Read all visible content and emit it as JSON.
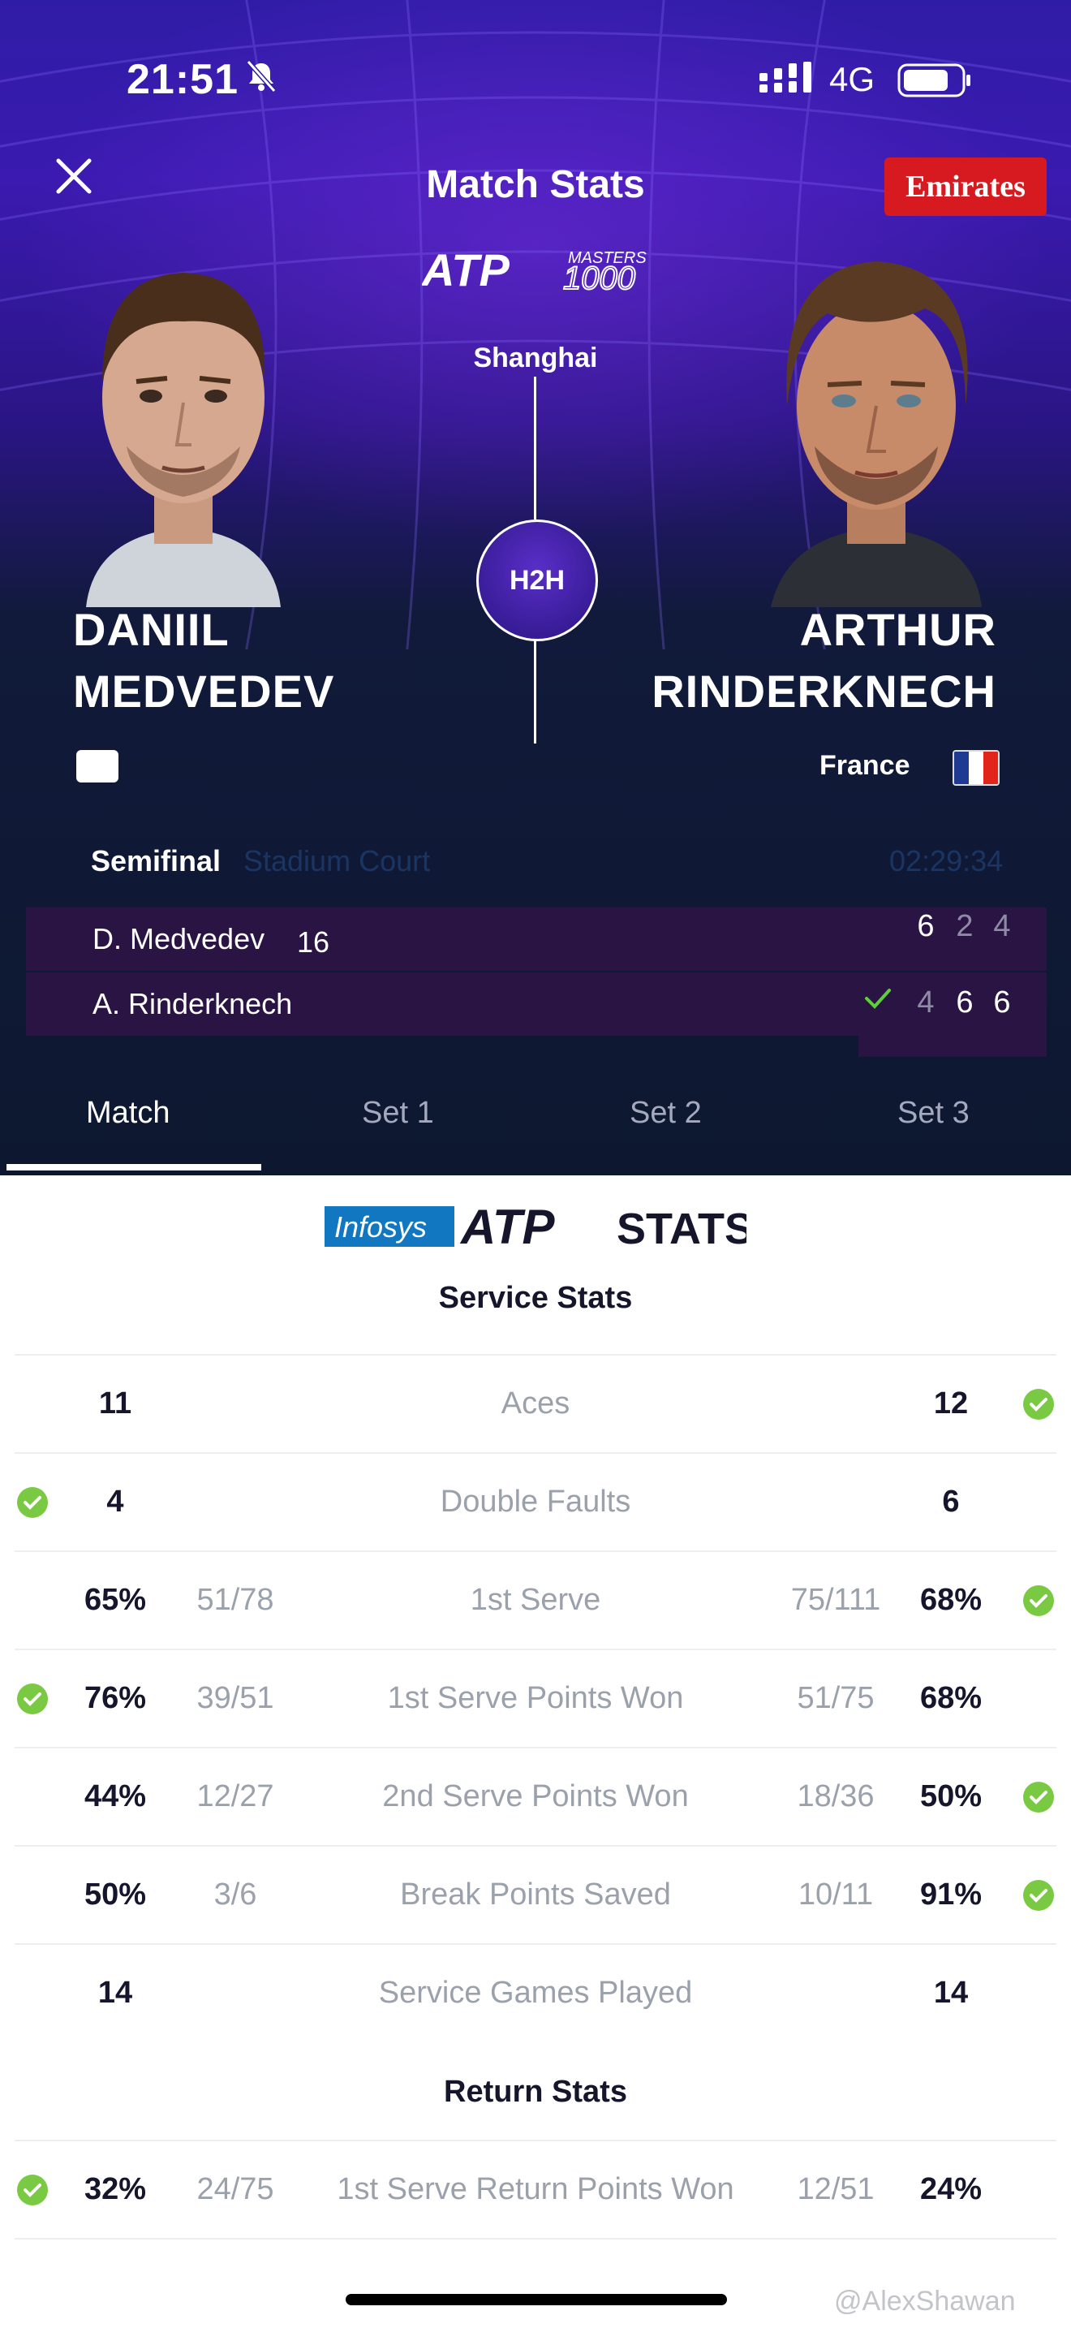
{
  "status_bar": {
    "time": "21:51",
    "network": "4G"
  },
  "header": {
    "title": "Match Stats",
    "sponsor": "Emirates",
    "tournament_logo_text": "ATP MASTERS 1000"
  },
  "match": {
    "city": "Shanghai",
    "h2h_label": "H2H",
    "player1": {
      "first": "DANIIL",
      "last": "MEDVEDEV",
      "country": ""
    },
    "player2": {
      "first": "ARTHUR",
      "last": "RINDERKNECH",
      "country": "France"
    },
    "round": "Semifinal",
    "court": "Stadium Court",
    "duration": "02:29:34"
  },
  "scoreboard": {
    "rows": [
      {
        "name": "D. Medvedev",
        "seed": "16",
        "sets": [
          "6",
          "2",
          "4"
        ]
      },
      {
        "name": "A. Rinderknech",
        "seed": "",
        "sets": [
          "4",
          "6",
          "6"
        ]
      }
    ]
  },
  "tabs": [
    "Match",
    "Set 1",
    "Set 2",
    "Set 3"
  ],
  "stats_brand": {
    "infosys": "Infosys",
    "atp": "ATP",
    "stats": "STATS"
  },
  "service_title": "Service Stats",
  "return_title": "Return Stats",
  "service_stats": [
    {
      "label": "Aces",
      "left": "11",
      "left_frac": "",
      "right_frac": "",
      "right": "12",
      "winner": "right"
    },
    {
      "label": "Double Faults",
      "left": "4",
      "left_frac": "",
      "right_frac": "",
      "right": "6",
      "winner": "left"
    },
    {
      "label": "1st Serve",
      "left": "65%",
      "left_frac": "51/78",
      "right_frac": "75/111",
      "right": "68%",
      "winner": "right"
    },
    {
      "label": "1st Serve Points Won",
      "left": "76%",
      "left_frac": "39/51",
      "right_frac": "51/75",
      "right": "68%",
      "winner": "left"
    },
    {
      "label": "2nd Serve Points Won",
      "left": "44%",
      "left_frac": "12/27",
      "right_frac": "18/36",
      "right": "50%",
      "winner": "right"
    },
    {
      "label": "Break Points Saved",
      "left": "50%",
      "left_frac": "3/6",
      "right_frac": "10/11",
      "right": "91%",
      "winner": "right"
    },
    {
      "label": "Service Games Played",
      "left": "14",
      "left_frac": "",
      "right_frac": "",
      "right": "14",
      "winner": "none"
    }
  ],
  "return_stats": [
    {
      "label": "1st Serve Return Points Won",
      "left": "32%",
      "left_frac": "24/75",
      "right_frac": "12/51",
      "right": "24%",
      "winner": "left"
    }
  ],
  "watermark": "@AlexShawan",
  "colors": {
    "check_green": "#7ac943",
    "sponsor_red": "#d71920"
  }
}
